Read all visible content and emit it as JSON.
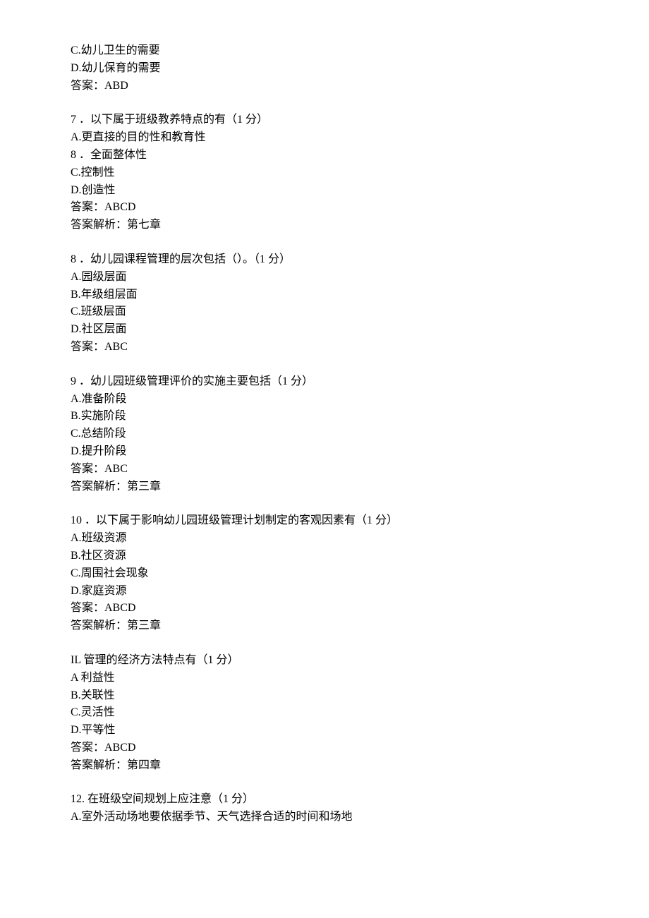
{
  "fragment_top": {
    "lines": [
      "C.幼儿卫生的需要",
      "D.幼儿保育的需要",
      "答案：ABD"
    ]
  },
  "q7": {
    "stem": "7 ．以下属于班级教养特点的有（1 分）",
    "opts": [
      "A.更直接的目的性和教育性",
      "8 ．全面整体性",
      "C.控制性",
      "D.创造性"
    ],
    "answer": "答案：ABCD",
    "analysis": "答案解析：第七章"
  },
  "q8": {
    "stem": "8 ．幼儿园课程管理的层次包括（）。（1 分）",
    "opts": [
      "A.园级层面",
      "B.年级组层面",
      "C.班级层面",
      "D.社区层面"
    ],
    "answer": "答案：ABC"
  },
  "q9": {
    "stem": "9 ．幼儿园班级管理评价的实施主要包括（1 分）",
    "opts": [
      "A.准备阶段",
      "B.实施阶段",
      "C.总结阶段",
      "D.提升阶段"
    ],
    "answer": "答案：ABC",
    "analysis": "答案解析：第三章"
  },
  "q10": {
    "stem": "10 ．以下属于影响幼儿园班级管理计划制定的客观因素有（1 分）",
    "opts": [
      "A.班级资源",
      "B.社区资源",
      "C.周围社会现象",
      "D.家庭资源"
    ],
    "answer": "答案：ABCD",
    "analysis": "答案解析：第三章"
  },
  "q11": {
    "stem": "IL 管理的经济方法特点有（1 分）",
    "opts": [
      "A 利益性",
      "B.关联性",
      "C.灵活性",
      "D.平等性"
    ],
    "answer": "答案：ABCD",
    "analysis": "答案解析：第四章"
  },
  "q12": {
    "stem": "12. 在班级空间规划上应注意（1 分）",
    "opts": [
      "A.室外活动场地要依据季节、天气选择合适的时间和场地"
    ]
  }
}
